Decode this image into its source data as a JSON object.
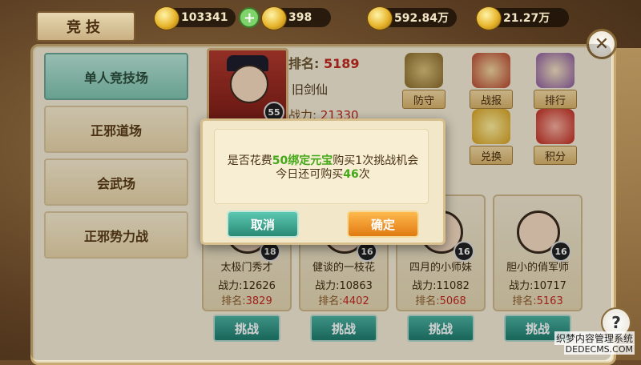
{
  "header": {
    "title": "竞技",
    "resources": [
      {
        "value": "103341",
        "icon": "gold-ingot-icon",
        "addable": true
      },
      {
        "value": "398",
        "icon": "bound-ingot-icon",
        "addable": false
      },
      {
        "value": "592.84万",
        "icon": "coin-icon",
        "addable": false
      },
      {
        "value": "21.27万",
        "icon": "coin-icon",
        "addable": false
      }
    ]
  },
  "sidebar": {
    "items": [
      {
        "label": "单人竞技场",
        "active": true
      },
      {
        "label": "正邪道场",
        "active": false
      },
      {
        "label": "会武场",
        "active": false
      },
      {
        "label": "正邪势力战",
        "active": false
      }
    ]
  },
  "profile": {
    "rank_label": "排名:",
    "rank_value": "5189",
    "name": "旧剑仙",
    "power_label": "战力:",
    "power_value": "21330",
    "level": "55"
  },
  "actions": [
    {
      "label": "防守",
      "icon": "crossed-swords-icon"
    },
    {
      "label": "战报",
      "icon": "battle-report-icon"
    },
    {
      "label": "排行",
      "icon": "ranking-scroll-icon"
    },
    {
      "label": "兑换",
      "icon": "exchange-coins-icon"
    },
    {
      "label": "积分",
      "icon": "points-bag-icon"
    }
  ],
  "opponents": [
    {
      "name": "太极门秀才",
      "power_label": "战力:",
      "power": "12626",
      "rank_label": "排名:",
      "rank": "3829",
      "level": "18"
    },
    {
      "name": "健谈的一枝花",
      "power_label": "战力:",
      "power": "10863",
      "rank_label": "排名:",
      "rank": "4402",
      "level": "16"
    },
    {
      "name": "四月的小师妹",
      "power_label": "战力:",
      "power": "11082",
      "rank_label": "排名:",
      "rank": "5068",
      "level": "16"
    },
    {
      "name": "胆小的俏军师",
      "power_label": "战力:",
      "power": "10717",
      "rank_label": "排名:",
      "rank": "5163",
      "level": "16"
    }
  ],
  "fight_label": "挑战",
  "dialog": {
    "line1_prefix": "是否花费",
    "line1_highlight": "50绑定元宝",
    "line1_suffix": "购买1次挑战机会",
    "line2_prefix": "今日还可购买",
    "line2_highlight": "46",
    "line2_suffix": "次",
    "cancel_label": "取消",
    "ok_label": "确定"
  },
  "help_label": "?",
  "watermark": {
    "line1": "织梦内容管理系统",
    "line2": "DEDECMS.COM"
  },
  "colors": {
    "highlight_green": "#43a818",
    "rank_red": "#c0291e",
    "teal_button": "#2a8a76",
    "orange_button": "#e07a12"
  }
}
